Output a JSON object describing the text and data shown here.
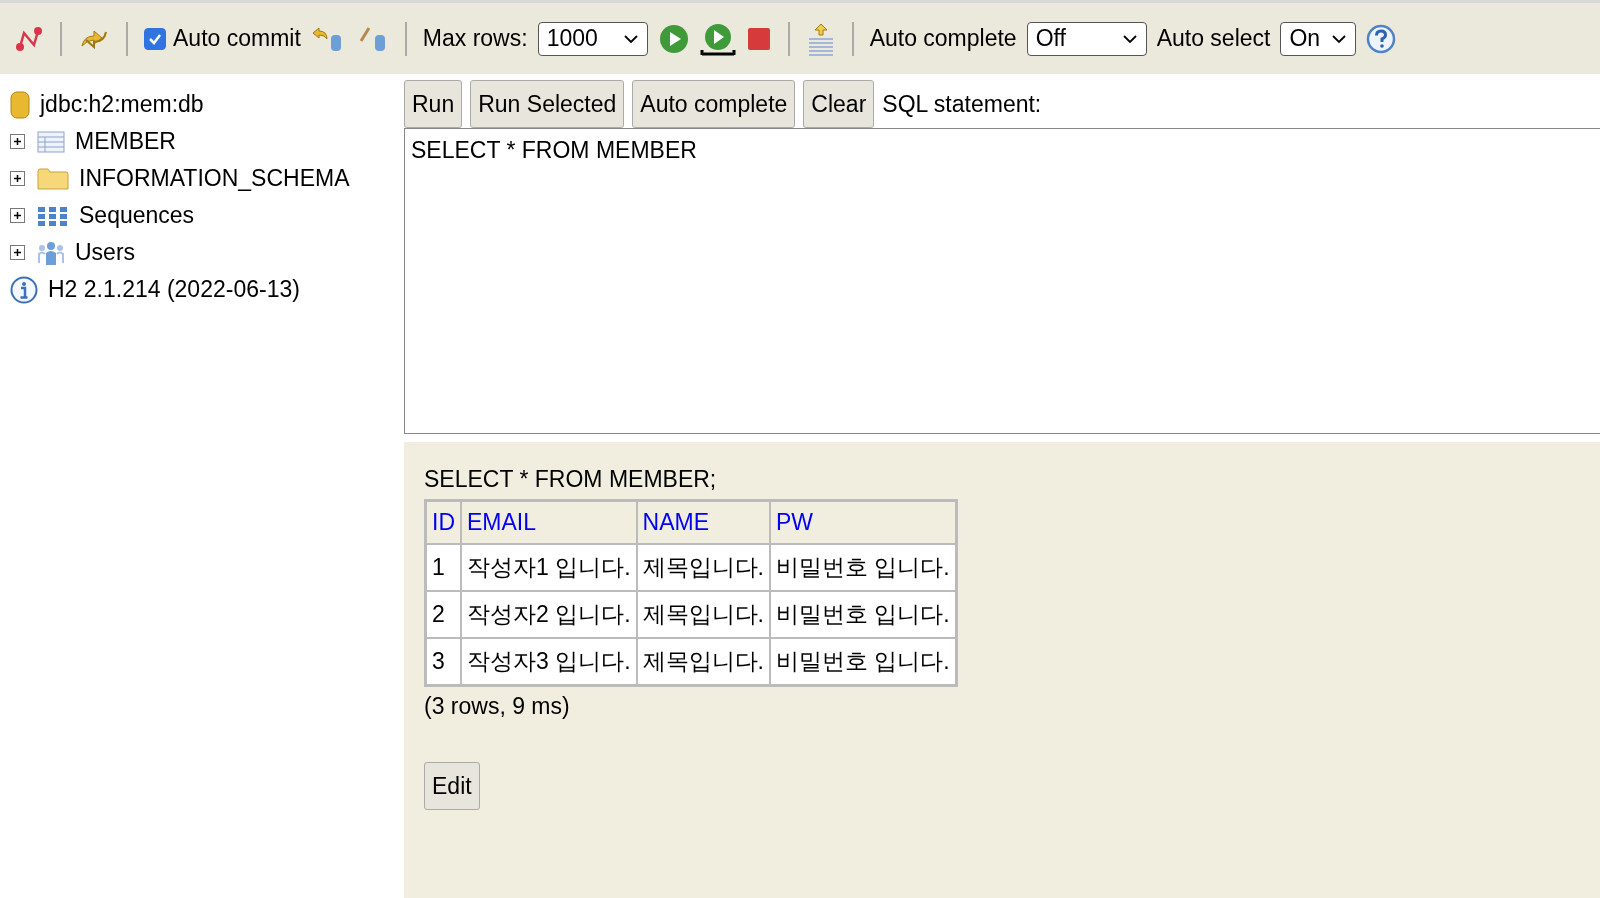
{
  "toolbar": {
    "auto_commit": {
      "label": "Auto commit",
      "checked": true
    },
    "max_rows": {
      "label": "Max rows:",
      "value": "1000"
    },
    "auto_complete": {
      "label": "Auto complete",
      "value": "Off"
    },
    "auto_select": {
      "label": "Auto select",
      "value": "On"
    }
  },
  "sidebar": {
    "connection": "jdbc:h2:mem:db",
    "items": [
      {
        "label": "MEMBER",
        "kind": "table",
        "expanded": false
      },
      {
        "label": "INFORMATION_SCHEMA",
        "kind": "folder",
        "expanded": false
      },
      {
        "label": "Sequences",
        "kind": "sequences",
        "expanded": false
      },
      {
        "label": "Users",
        "kind": "users",
        "expanded": false
      }
    ],
    "version": "H2 2.1.214 (2022-06-13)"
  },
  "editor_buttons": [
    "Run",
    "Run Selected",
    "Auto complete",
    "Clear"
  ],
  "sql_label": "SQL statement:",
  "sql_text": "SELECT * FROM MEMBER",
  "result": {
    "query": "SELECT * FROM MEMBER;",
    "columns": [
      "ID",
      "EMAIL",
      "NAME",
      "PW"
    ],
    "rows": [
      [
        "1",
        "작성자1 입니다.",
        "제목입니다.",
        "비밀번호 입니다."
      ],
      [
        "2",
        "작성자2 입니다.",
        "제목입니다.",
        "비밀번호 입니다."
      ],
      [
        "3",
        "작성자3 입니다.",
        "제목입니다.",
        "비밀번호 입니다."
      ]
    ],
    "summary": "(3 rows, 9 ms)",
    "edit_button": "Edit"
  }
}
